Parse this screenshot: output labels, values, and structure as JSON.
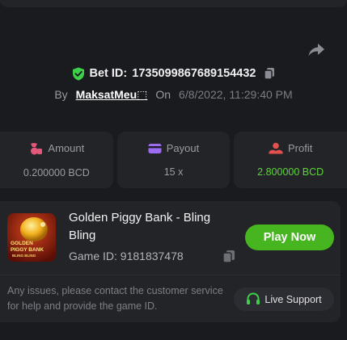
{
  "bet": {
    "prefix": "Bet ID:",
    "id": "1735099867689154432",
    "by_label": "By",
    "user": "MaksatMeu⬚",
    "on_label": "On",
    "date": "6/8/2022, 11:29:40 PM"
  },
  "stats": {
    "amount": {
      "label": "Amount",
      "value": "0.200000 BCD"
    },
    "payout": {
      "label": "Payout",
      "value": "15 x"
    },
    "profit": {
      "label": "Profit",
      "value": "2.800000 BCD"
    }
  },
  "game": {
    "title": "Golden Piggy Bank - Bling Bling",
    "id_label": "Game ID: 9181837478",
    "thumb_text_1": "GOLDEN",
    "thumb_text_2": "PIGGY BANK",
    "thumb_text_3": "BLING BLING",
    "play_label": "Play Now"
  },
  "help": {
    "text": "Any issues, please contact the customer service for help and provide the game ID.",
    "support_label": "Live Support"
  },
  "colors": {
    "background": "#1a1b1f",
    "card": "#232428",
    "accent_green": "#47b51f",
    "profit_green": "#5fd43a",
    "shield_green": "#3ecf4a",
    "amount_icon": "#e2577a",
    "payout_icon": "#9b6cf0",
    "profit_icon": "#e3514f"
  },
  "icons": [
    "share-icon",
    "shield-check-icon",
    "copy-icon",
    "coins-icon",
    "wallet-card-icon",
    "hand-coin-icon",
    "headset-icon"
  ]
}
